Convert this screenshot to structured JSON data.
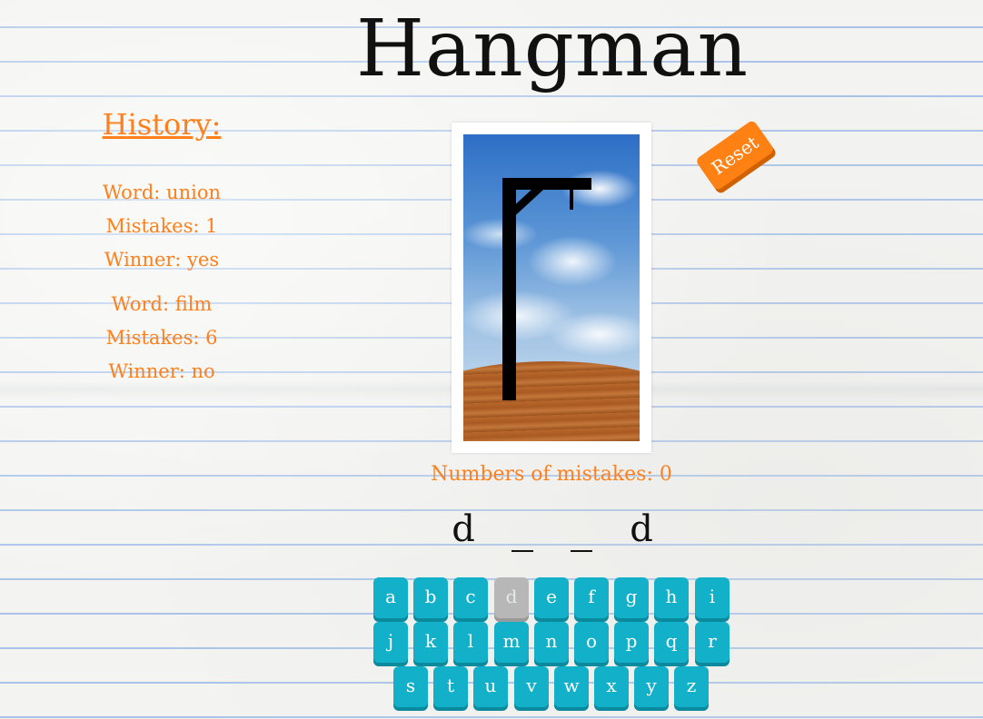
{
  "title": "Hangman",
  "history": {
    "heading": "History:",
    "entries": [
      {
        "word": "Word: union",
        "mistakes": "Mistakes: 1",
        "winner": "Winner: yes"
      },
      {
        "word": "Word: film",
        "mistakes": "Mistakes: 6",
        "winner": "Winner: no"
      }
    ]
  },
  "reset_label": "Reset",
  "mistakes_label": "Numbers of mistakes: 0",
  "word_display": [
    "d",
    "",
    "",
    "d"
  ],
  "keyboard": {
    "rows": [
      [
        "a",
        "b",
        "c",
        "d",
        "e",
        "f",
        "g",
        "h",
        "i"
      ],
      [
        "j",
        "k",
        "l",
        "m",
        "n",
        "o",
        "p",
        "q",
        "r"
      ],
      [
        "s",
        "t",
        "u",
        "v",
        "w",
        "x",
        "y",
        "z"
      ]
    ],
    "used": [
      "d"
    ]
  },
  "colors": {
    "accent": "#ff7f1a",
    "key": "#12b0c9",
    "key_used": "#b7b7b7",
    "reset": "#ff8013"
  }
}
